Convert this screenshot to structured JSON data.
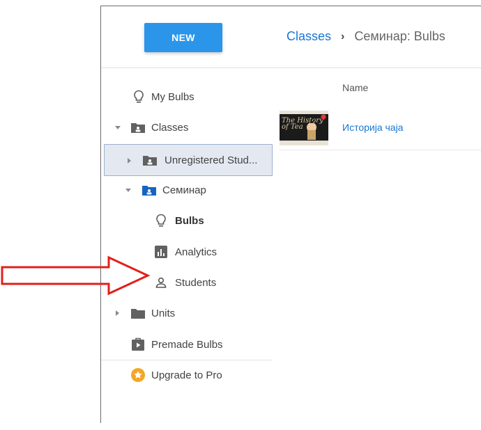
{
  "header": {
    "new_button": "NEW",
    "breadcrumb": {
      "link": "Classes",
      "separator": "›",
      "current": "Семинар: Bulbs"
    }
  },
  "sidebar": {
    "my_bulbs": "My Bulbs",
    "classes": "Classes",
    "unregistered": "Unregistered Stud...",
    "seminar": "Семинар",
    "bulbs": "Bulbs",
    "analytics": "Analytics",
    "students": "Students",
    "units": "Units",
    "premade": "Premade Bulbs",
    "upgrade": "Upgrade to Pro"
  },
  "main": {
    "column_name": "Name",
    "files": [
      {
        "name": "Историја чаја",
        "thumb_title": "The History of Tea"
      }
    ]
  },
  "colors": {
    "accent": "#2b95ea",
    "link": "#1976d2",
    "annotation_arrow": "#e0201c",
    "upgrade_badge": "#f5a623"
  }
}
